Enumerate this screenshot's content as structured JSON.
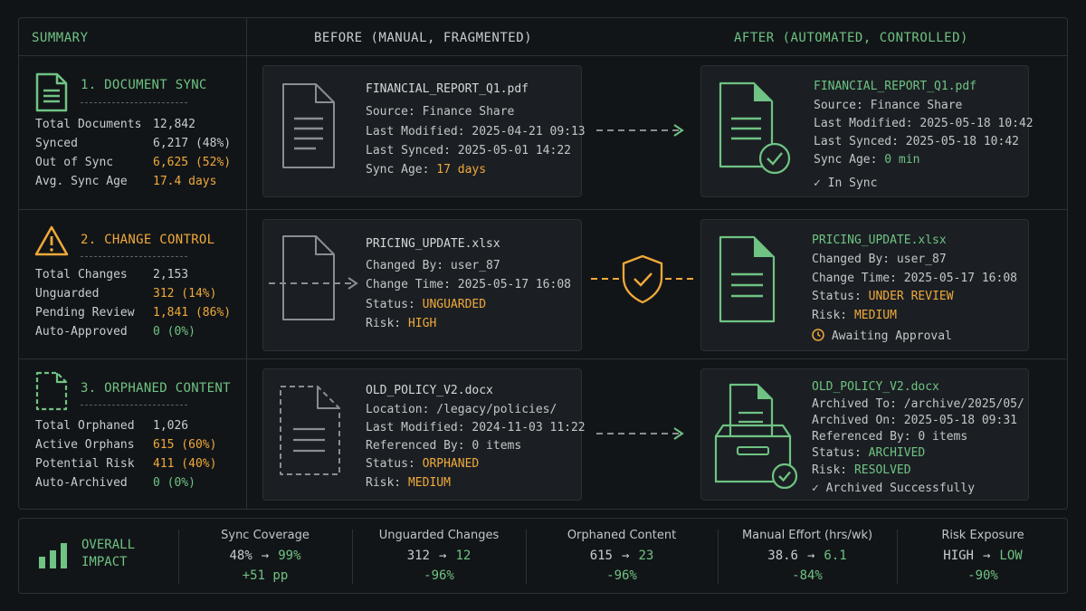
{
  "header": {
    "summary": "SUMMARY",
    "before": "BEFORE (MANUAL, FRAGMENTED)",
    "after": "AFTER (AUTOMATED, CONTROLLED)"
  },
  "sections": [
    {
      "title": "1. DOCUMENT SYNC",
      "icon": "document-icon",
      "stats": [
        {
          "label": "Total Documents",
          "value": "12,842"
        },
        {
          "label": "Synced",
          "value": "6,217 (48%)"
        },
        {
          "label": "Out of Sync",
          "value": "6,625 (52%)"
        },
        {
          "label": "Avg. Sync Age",
          "value": "17.4 days"
        }
      ],
      "before": {
        "file": "FINANCIAL_REPORT_Q1.pdf",
        "lines": [
          {
            "label": "Source:",
            "value": "Finance Share"
          },
          {
            "label": "Last Modified:",
            "value": "2025-04-21 09:13"
          },
          {
            "label": "Last Synced:",
            "value": "2025-05-01 14:22"
          },
          {
            "label": "Sync Age:",
            "value": "17 days"
          }
        ]
      },
      "after": {
        "file": "FINANCIAL_REPORT_Q1.pdf",
        "lines": [
          {
            "label": "Source:",
            "value": "Finance Share"
          },
          {
            "label": "Last Modified:",
            "value": "2025-05-18 10:42"
          },
          {
            "label": "Last Synced:",
            "value": "2025-05-18 10:42"
          },
          {
            "label": "Sync Age:",
            "value": "0 min"
          }
        ],
        "status": "In Sync"
      }
    },
    {
      "title": "2. CHANGE CONTROL",
      "icon": "warning-icon",
      "stats": [
        {
          "label": "Total Changes",
          "value": "2,153"
        },
        {
          "label": "Unguarded",
          "value": "312 (14%)"
        },
        {
          "label": "Pending Review",
          "value": "1,841 (86%)"
        },
        {
          "label": "Auto-Approved",
          "value": "0 (0%)"
        }
      ],
      "before": {
        "file": "PRICING_UPDATE.xlsx",
        "lines": [
          {
            "label": "Changed By:",
            "value": "user_87"
          },
          {
            "label": "Change Time:",
            "value": "2025-05-17 16:08"
          },
          {
            "label": "Status:",
            "value": "UNGUARDED"
          },
          {
            "label": "Risk:",
            "value": "HIGH"
          }
        ]
      },
      "after": {
        "file": "PRICING_UPDATE.xlsx",
        "lines": [
          {
            "label": "Changed By:",
            "value": "user_87"
          },
          {
            "label": "Change Time:",
            "value": "2025-05-17 16:08"
          },
          {
            "label": "Status:",
            "value": "UNDER REVIEW"
          },
          {
            "label": "Risk:",
            "value": "MEDIUM"
          }
        ],
        "status": "Awaiting Approval"
      }
    },
    {
      "title": "3. ORPHANED CONTENT",
      "icon": "dashed-document-icon",
      "stats": [
        {
          "label": "Total Orphaned",
          "value": "1,026"
        },
        {
          "label": "Active Orphans",
          "value": "615 (60%)"
        },
        {
          "label": "Potential Risk",
          "value": "411 (40%)"
        },
        {
          "label": "Auto-Archived",
          "value": "0 (0%)"
        }
      ],
      "before": {
        "file": "OLD_POLICY_V2.docx",
        "lines": [
          {
            "label": "Location:",
            "value": "/legacy/policies/"
          },
          {
            "label": "Last Modified:",
            "value": "2024-11-03 11:22"
          },
          {
            "label": "Referenced By:",
            "value": "0 items"
          },
          {
            "label": "Status:",
            "value": "ORPHANED"
          },
          {
            "label": "Risk:",
            "value": "MEDIUM"
          }
        ]
      },
      "after": {
        "file": "OLD_POLICY_V2.docx",
        "lines": [
          {
            "label": "Archived To:",
            "value": "/archive/2025/05/"
          },
          {
            "label": "Archived On:",
            "value": "2025-05-18 09:31"
          },
          {
            "label": "Referenced By:",
            "value": "0 items"
          },
          {
            "label": "Status:",
            "value": "ARCHIVED"
          },
          {
            "label": "Risk:",
            "value": "RESOLVED"
          }
        ],
        "status": "Archived Successfully"
      }
    }
  ],
  "impact": {
    "title_line1": "OVERALL",
    "title_line2": "IMPACT",
    "metrics": [
      {
        "label": "Sync Coverage",
        "before": "48%",
        "after": "99%",
        "delta": "+51 pp"
      },
      {
        "label": "Unguarded Changes",
        "before": "312",
        "after": "12",
        "delta": "-96%"
      },
      {
        "label": "Orphaned Content",
        "before": "615",
        "after": "23",
        "delta": "-96%"
      },
      {
        "label": "Manual Effort (hrs/wk)",
        "before": "38.6",
        "after": "6.1",
        "delta": "-84%"
      },
      {
        "label": "Risk Exposure",
        "before": "HIGH",
        "after": "LOW",
        "delta": "-90%"
      }
    ]
  },
  "colors": {
    "green": "#6fc383",
    "orange": "#f0a93a",
    "background": "#111417",
    "card": "#1b1f23"
  }
}
